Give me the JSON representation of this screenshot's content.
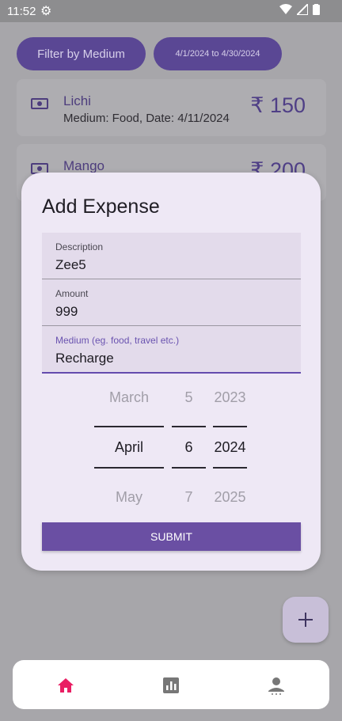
{
  "status_bar": {
    "time": "11:52"
  },
  "filters": {
    "medium_label": "Filter by Medium",
    "date_range_label": "4/1/2024 to 4/30/2024"
  },
  "expenses": [
    {
      "title": "Lichi",
      "subtitle": "Medium: Food, Date: 4/11/2024",
      "amount": "₹ 150"
    },
    {
      "title": "Mango",
      "subtitle": "",
      "amount": "₹ 200"
    }
  ],
  "dialog": {
    "title": "Add Expense",
    "fields": [
      {
        "label": "Description",
        "value": "Zee5"
      },
      {
        "label": "Amount",
        "value": "999"
      },
      {
        "label": "Medium (eg. food, travel etc.)",
        "value": "Recharge"
      }
    ],
    "date_picker": {
      "month": {
        "prev": "March",
        "current": "April",
        "next": "May"
      },
      "day": {
        "prev": "5",
        "current": "6",
        "next": "7"
      },
      "year": {
        "prev": "2023",
        "current": "2024",
        "next": "2025"
      }
    },
    "submit_label": "SUBMIT"
  },
  "fab": {
    "icon": "plus-icon"
  },
  "bottom_nav": [
    {
      "icon": "home-icon",
      "active": true,
      "color": "#e91e63"
    },
    {
      "icon": "chart-icon",
      "active": false,
      "color": "#777777"
    },
    {
      "icon": "person-icon",
      "active": false,
      "color": "#777777"
    }
  ]
}
